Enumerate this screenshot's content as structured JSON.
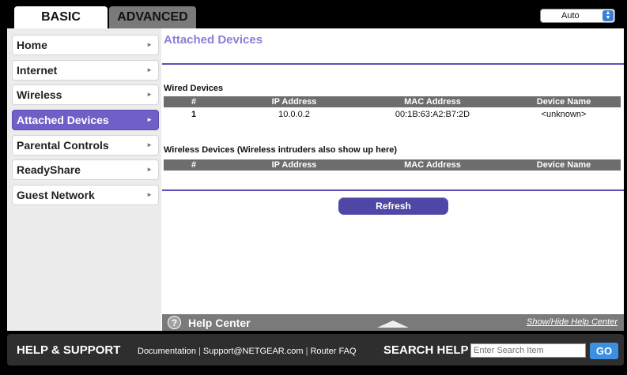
{
  "tabs": {
    "basic": "BASIC",
    "advanced": "ADVANCED"
  },
  "language_select": {
    "value": "Auto"
  },
  "sidebar": {
    "items": [
      {
        "label": "Home"
      },
      {
        "label": "Internet"
      },
      {
        "label": "Wireless"
      },
      {
        "label": "Attached Devices"
      },
      {
        "label": "Parental Controls"
      },
      {
        "label": "ReadyShare"
      },
      {
        "label": "Guest Network"
      }
    ],
    "active_index": 3
  },
  "main": {
    "title": "Attached Devices",
    "wired": {
      "label": "Wired Devices",
      "headers": [
        "#",
        "IP Address",
        "MAC Address",
        "Device Name"
      ],
      "rows": [
        {
          "num": "1",
          "ip": "10.0.0.2",
          "mac": "00:1B:63:A2:B7:2D",
          "name": "<unknown>"
        }
      ]
    },
    "wireless": {
      "label": "Wireless Devices (Wireless intruders also show up here)",
      "headers": [
        "#",
        "IP Address",
        "MAC Address",
        "Device Name"
      ],
      "rows": []
    },
    "refresh_label": "Refresh"
  },
  "help_center": {
    "title": "Help Center",
    "toggle": "Show/Hide Help Center",
    "icon_label": "?"
  },
  "footer": {
    "title": "HELP & SUPPORT",
    "links": [
      "Documentation",
      "Support@NETGEAR.com",
      "Router FAQ"
    ],
    "search_title": "SEARCH HELP",
    "search_placeholder": "Enter Search Item",
    "go_label": "GO"
  },
  "colors": {
    "accent": "#6f5fc7",
    "title": "#8a7fd8",
    "table_header": "#6d6d6d",
    "go_button": "#3d8fe0"
  }
}
